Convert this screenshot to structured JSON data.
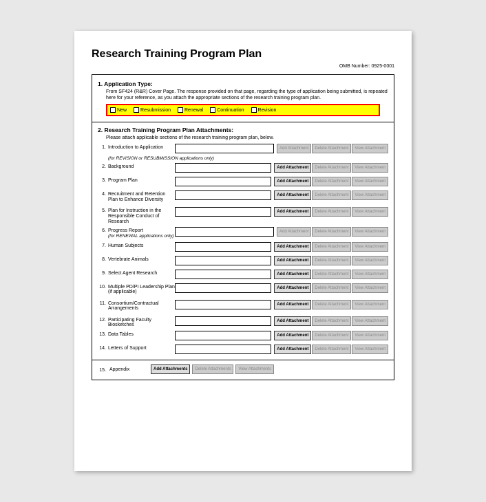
{
  "title": "Research Training Program Plan",
  "omb": "OMB Number: 0925-0001",
  "section1": {
    "title": "1. Application Type:",
    "desc": "From SF424 (R&R) Cover Page. The response provided on that page, regarding the type of application being submitted, is repeated here for your reference, as you attach the appropriate sections of the research training program plan.",
    "options": [
      "New",
      "Resubmission",
      "Renewal",
      "Continuation",
      "Revision"
    ]
  },
  "section2": {
    "title": "2. Research Training Program Plan Attachments:",
    "desc": "Please attach applicable sections of the research training program plan, below."
  },
  "buttons": {
    "add": "Add Attachment",
    "del": "Delete Attachment",
    "view": "View Attachment",
    "add_pl": "Add Attachments",
    "del_pl": "Delete Attachments",
    "view_pl": "View Attachments"
  },
  "rows": [
    {
      "num": "1.",
      "label": "Introduction to Application",
      "sub": "(for REVISION or RESUBMISSION applications only)",
      "disabled": true
    },
    {
      "num": "2.",
      "label": "Background"
    },
    {
      "num": "3.",
      "label": "Program Plan"
    },
    {
      "num": "4.",
      "label": "Recruitment and Retention Plan to Enhance Diversity",
      "tall": true
    },
    {
      "num": "5.",
      "label": "Plan for Instruction in the Responsible Conduct of Research",
      "tall": true
    },
    {
      "num": "6.",
      "label": "Progress Report",
      "sub2": "(for RENEWAL applications only)",
      "disabled": true
    },
    {
      "num": "7.",
      "label": "Human Subjects"
    },
    {
      "num": "8.",
      "label": "Vertebrate Animals"
    },
    {
      "num": "9.",
      "label": "Select Agent Research"
    },
    {
      "num": "10.",
      "label": "Multiple PD/PI Leadership Plan (if applicable)",
      "tall": true
    },
    {
      "num": "11.",
      "label": "Consortium/Contractual Arrangements",
      "tall": true
    },
    {
      "num": "12.",
      "label": "Participating Faculty Biosketches"
    },
    {
      "num": "13.",
      "label": "Data Tables"
    },
    {
      "num": "14.",
      "label": "Letters of Support"
    }
  ],
  "appendix": {
    "num": "15.",
    "label": "Appendix"
  }
}
